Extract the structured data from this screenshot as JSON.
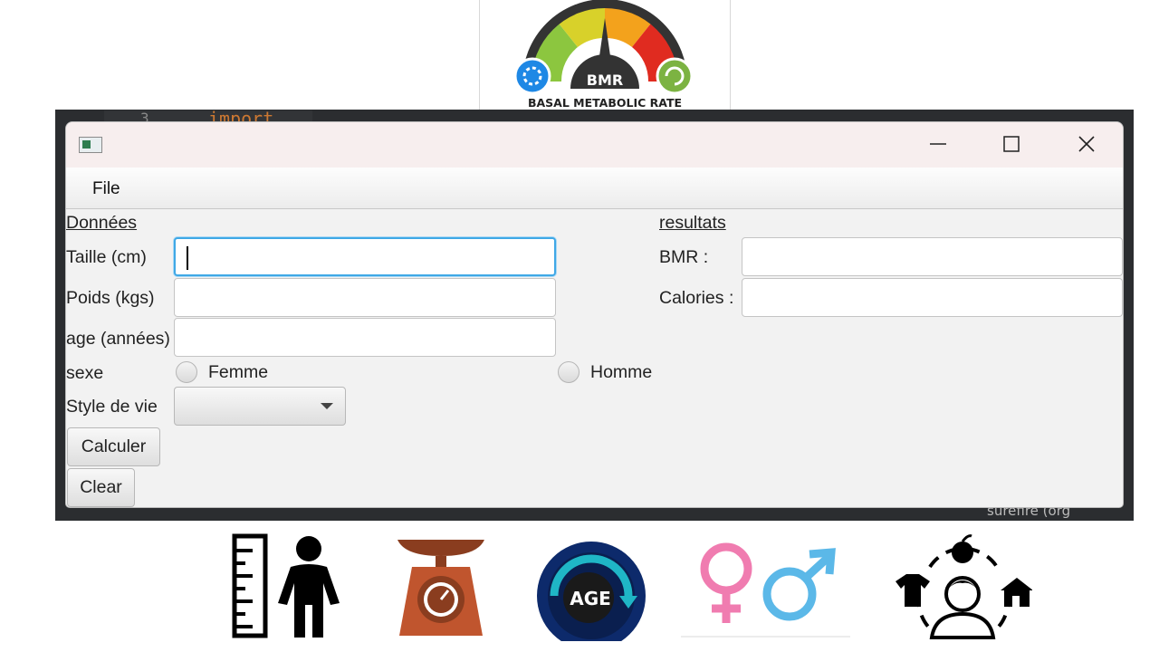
{
  "logo": {
    "badge": "BMR",
    "caption": "BASAL METABOLIC RATE"
  },
  "ide": {
    "line_number": "3",
    "code_text": "import",
    "bottom_text": "surefire (org"
  },
  "window": {
    "title": "",
    "minimize_icon": "minimize-icon",
    "maximize_icon": "maximize-icon",
    "close_icon": "close-icon"
  },
  "menu": {
    "items": [
      {
        "label": "File"
      }
    ]
  },
  "form": {
    "section_title": "Données",
    "fields": [
      {
        "label": "Taille (cm)",
        "value": ""
      },
      {
        "label": "Poids (kgs)",
        "value": ""
      },
      {
        "label": "age (années)",
        "value": ""
      }
    ],
    "sexe": {
      "label": "sexe",
      "options": [
        {
          "label": "Femme",
          "selected": false
        },
        {
          "label": "Homme",
          "selected": false
        }
      ]
    },
    "style": {
      "label": "Style de vie",
      "selected": ""
    },
    "buttons": {
      "calculer": "Calculer",
      "clear": "Clear"
    }
  },
  "results": {
    "section_title": "resultats",
    "fields": [
      {
        "label": "BMR :",
        "value": ""
      },
      {
        "label": "Calories :",
        "value": ""
      }
    ]
  },
  "bottom_icons": [
    {
      "icon": "height-ruler-person-icon"
    },
    {
      "icon": "weighing-scale-icon"
    },
    {
      "icon": "age-icon",
      "text": "AGE"
    },
    {
      "icon": "gender-symbols-icon"
    },
    {
      "icon": "lifestyle-icon"
    }
  ],
  "colors": {
    "focus": "#3fa8e6",
    "female": "#f07cb0",
    "male": "#5bb8e8",
    "scale": "#c0552e",
    "age_bg": "#0d2a6b"
  }
}
